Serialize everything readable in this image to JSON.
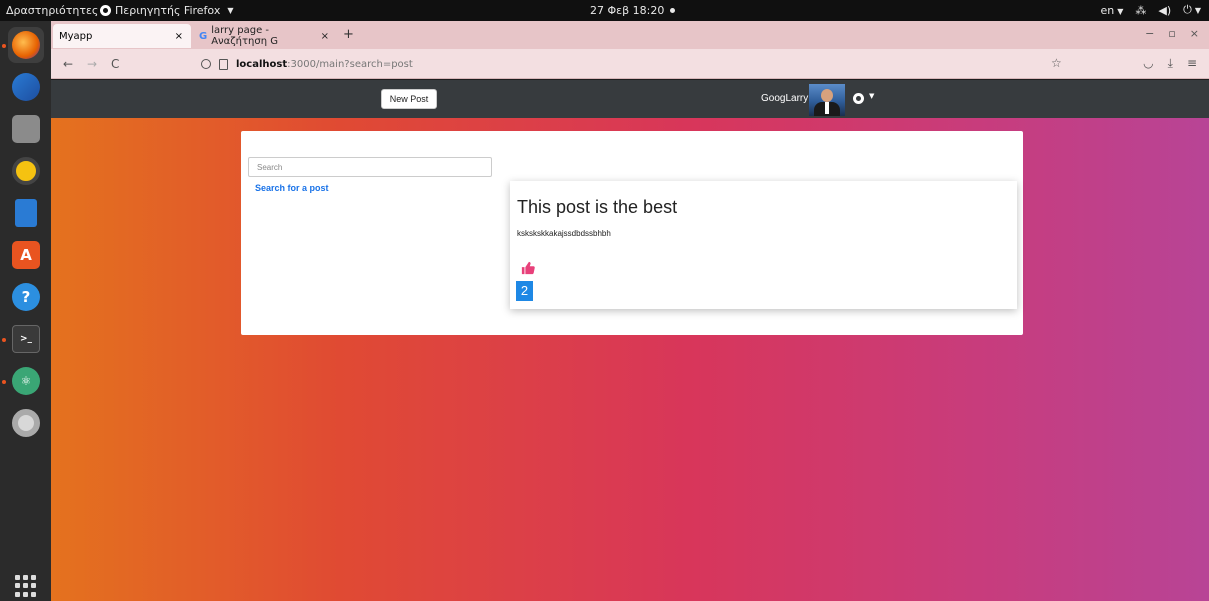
{
  "system": {
    "activities": "Δραστηριότητες",
    "app_menu": "Περιηγητής Firefox",
    "clock": "27 Φεβ  18:20",
    "keyboard_layout": "en"
  },
  "browser": {
    "tabs": [
      {
        "label": "Myapp"
      },
      {
        "label": "larry page - Αναζήτηση G"
      }
    ],
    "url_host": "localhost",
    "url_rest": ":3000/main?search=post"
  },
  "app": {
    "new_post_label": "New Post",
    "username": "GoogLarry",
    "search_placeholder": "Search",
    "search_link": "Search for a post",
    "posts": [
      {
        "title": "This post is the best",
        "body": "ksksksk​kakajssdbdssbhbh",
        "likes": "2"
      }
    ]
  },
  "colors": {
    "accent_blue": "#1e88e5",
    "like_pink": "#e8407a",
    "navbar_bg": "#373b3e"
  }
}
